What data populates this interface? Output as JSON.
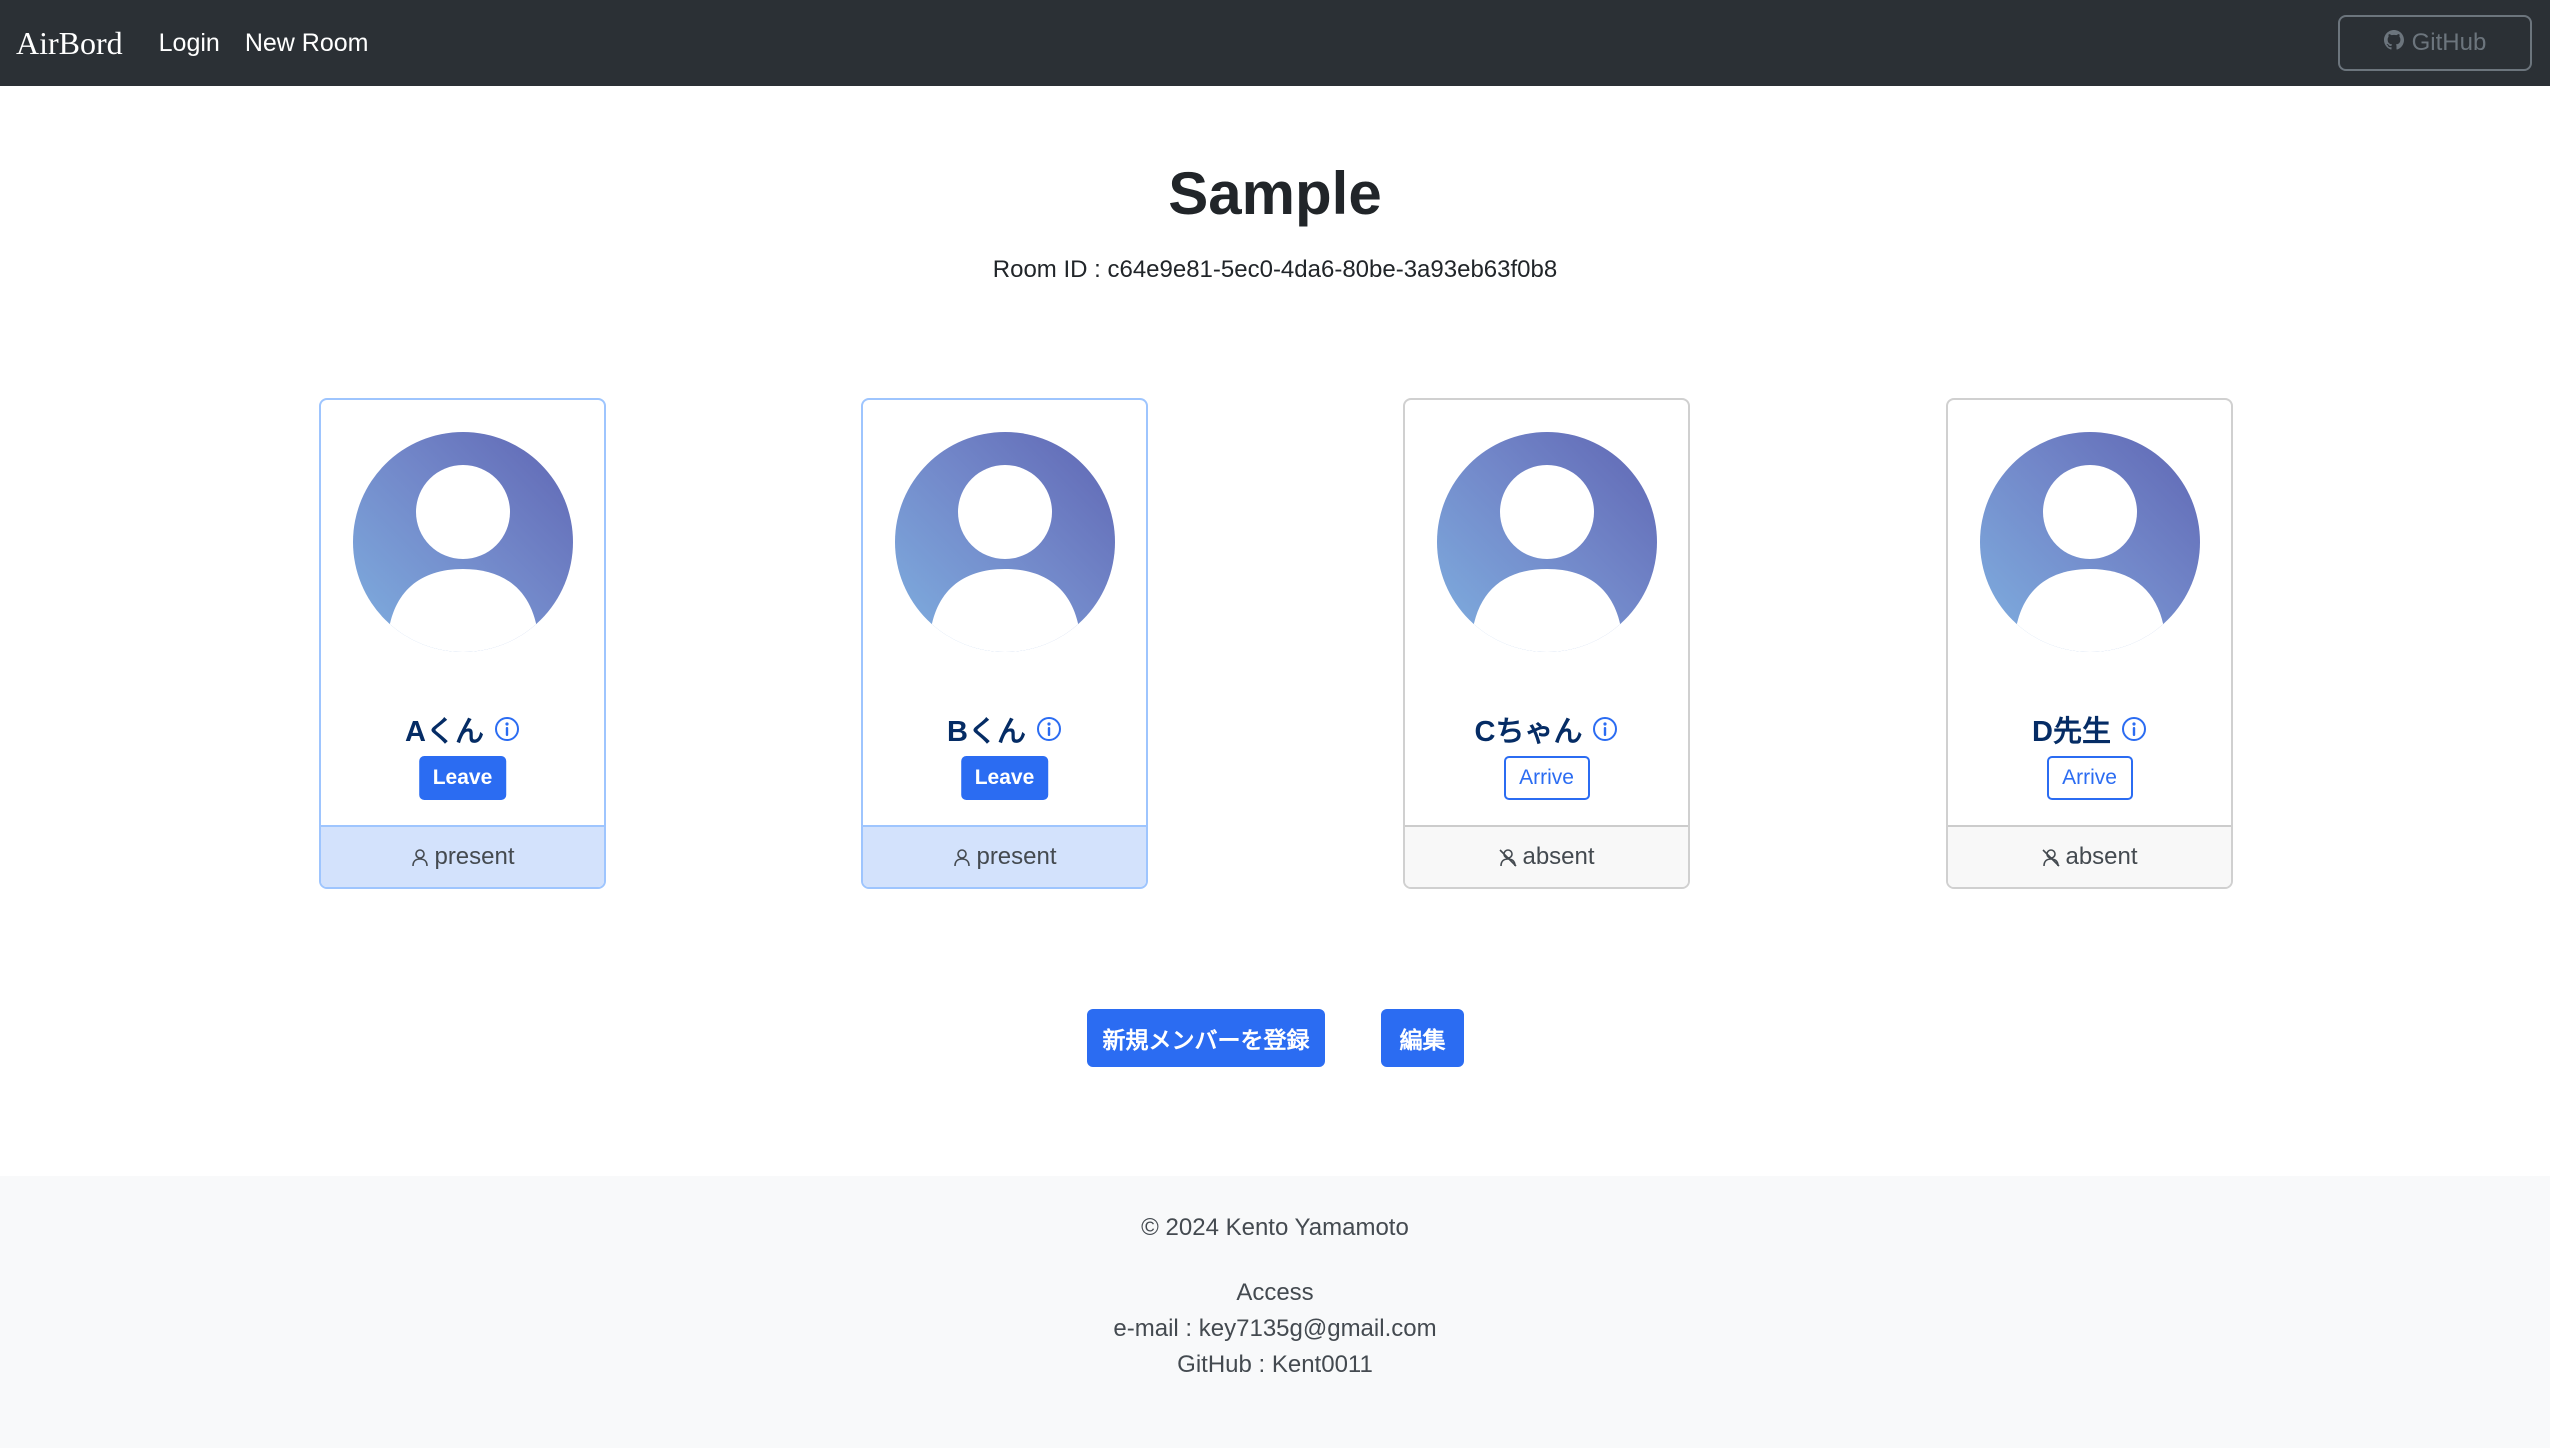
{
  "navbar": {
    "brand": "AirBord",
    "links": [
      "Login",
      "New Room"
    ],
    "github_label": "GitHub"
  },
  "header": {
    "title": "Sample",
    "room_id": "Room ID : c64e9e81-5ec0-4da6-80be-3a93eb63f0b8"
  },
  "members": [
    {
      "name": "Aくん",
      "button": "Leave",
      "status": "present"
    },
    {
      "name": "Bくん",
      "button": "Leave",
      "status": "present"
    },
    {
      "name": "Cちゃん",
      "button": "Arrive",
      "status": "absent"
    },
    {
      "name": "D先生",
      "button": "Arrive",
      "status": "absent"
    }
  ],
  "actions": {
    "register_label": "新規メンバーを登録",
    "edit_label": "編集"
  },
  "footer": {
    "copyright": "© 2024 Kento Yamamoto",
    "access_title": "Access",
    "email": "e-mail : key7135g@gmail.com",
    "github": "GitHub : Kent0011"
  },
  "colors": {
    "navbar_bg": "#2b3035",
    "accent": "#2b6cf2",
    "present_bg": "#d3e2fc",
    "absent_bg": "#f8f8f8",
    "name_color": "#052c65"
  }
}
